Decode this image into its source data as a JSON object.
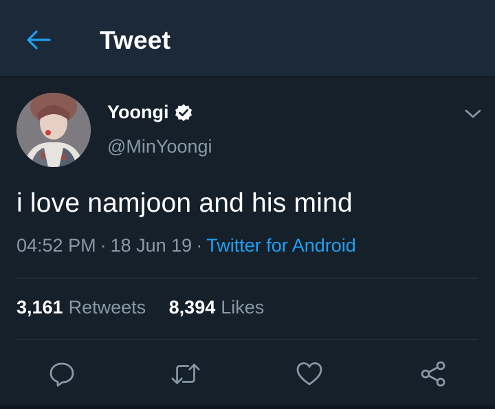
{
  "header": {
    "title": "Tweet",
    "back_icon": "arrow-left-icon"
  },
  "colors": {
    "background": "#15202b",
    "header_background": "#1c2938",
    "accent": "#1da1f2",
    "secondary_text": "#8899a6",
    "divider": "#38444d"
  },
  "tweet": {
    "author": {
      "display_name": "Yoongi",
      "handle": "@MinYoongi",
      "verified_icon": "verified-badge-icon"
    },
    "text": "i love namjoon and his mind",
    "time": "04:52 PM",
    "separator": "·",
    "date": "18 Jun 19",
    "source": "Twitter for Android",
    "stats": {
      "retweets_count": "3,161",
      "retweets_label": "Retweets",
      "likes_count": "8,394",
      "likes_label": "Likes"
    },
    "actions": [
      "reply-icon",
      "retweet-icon",
      "like-icon",
      "share-icon"
    ]
  }
}
